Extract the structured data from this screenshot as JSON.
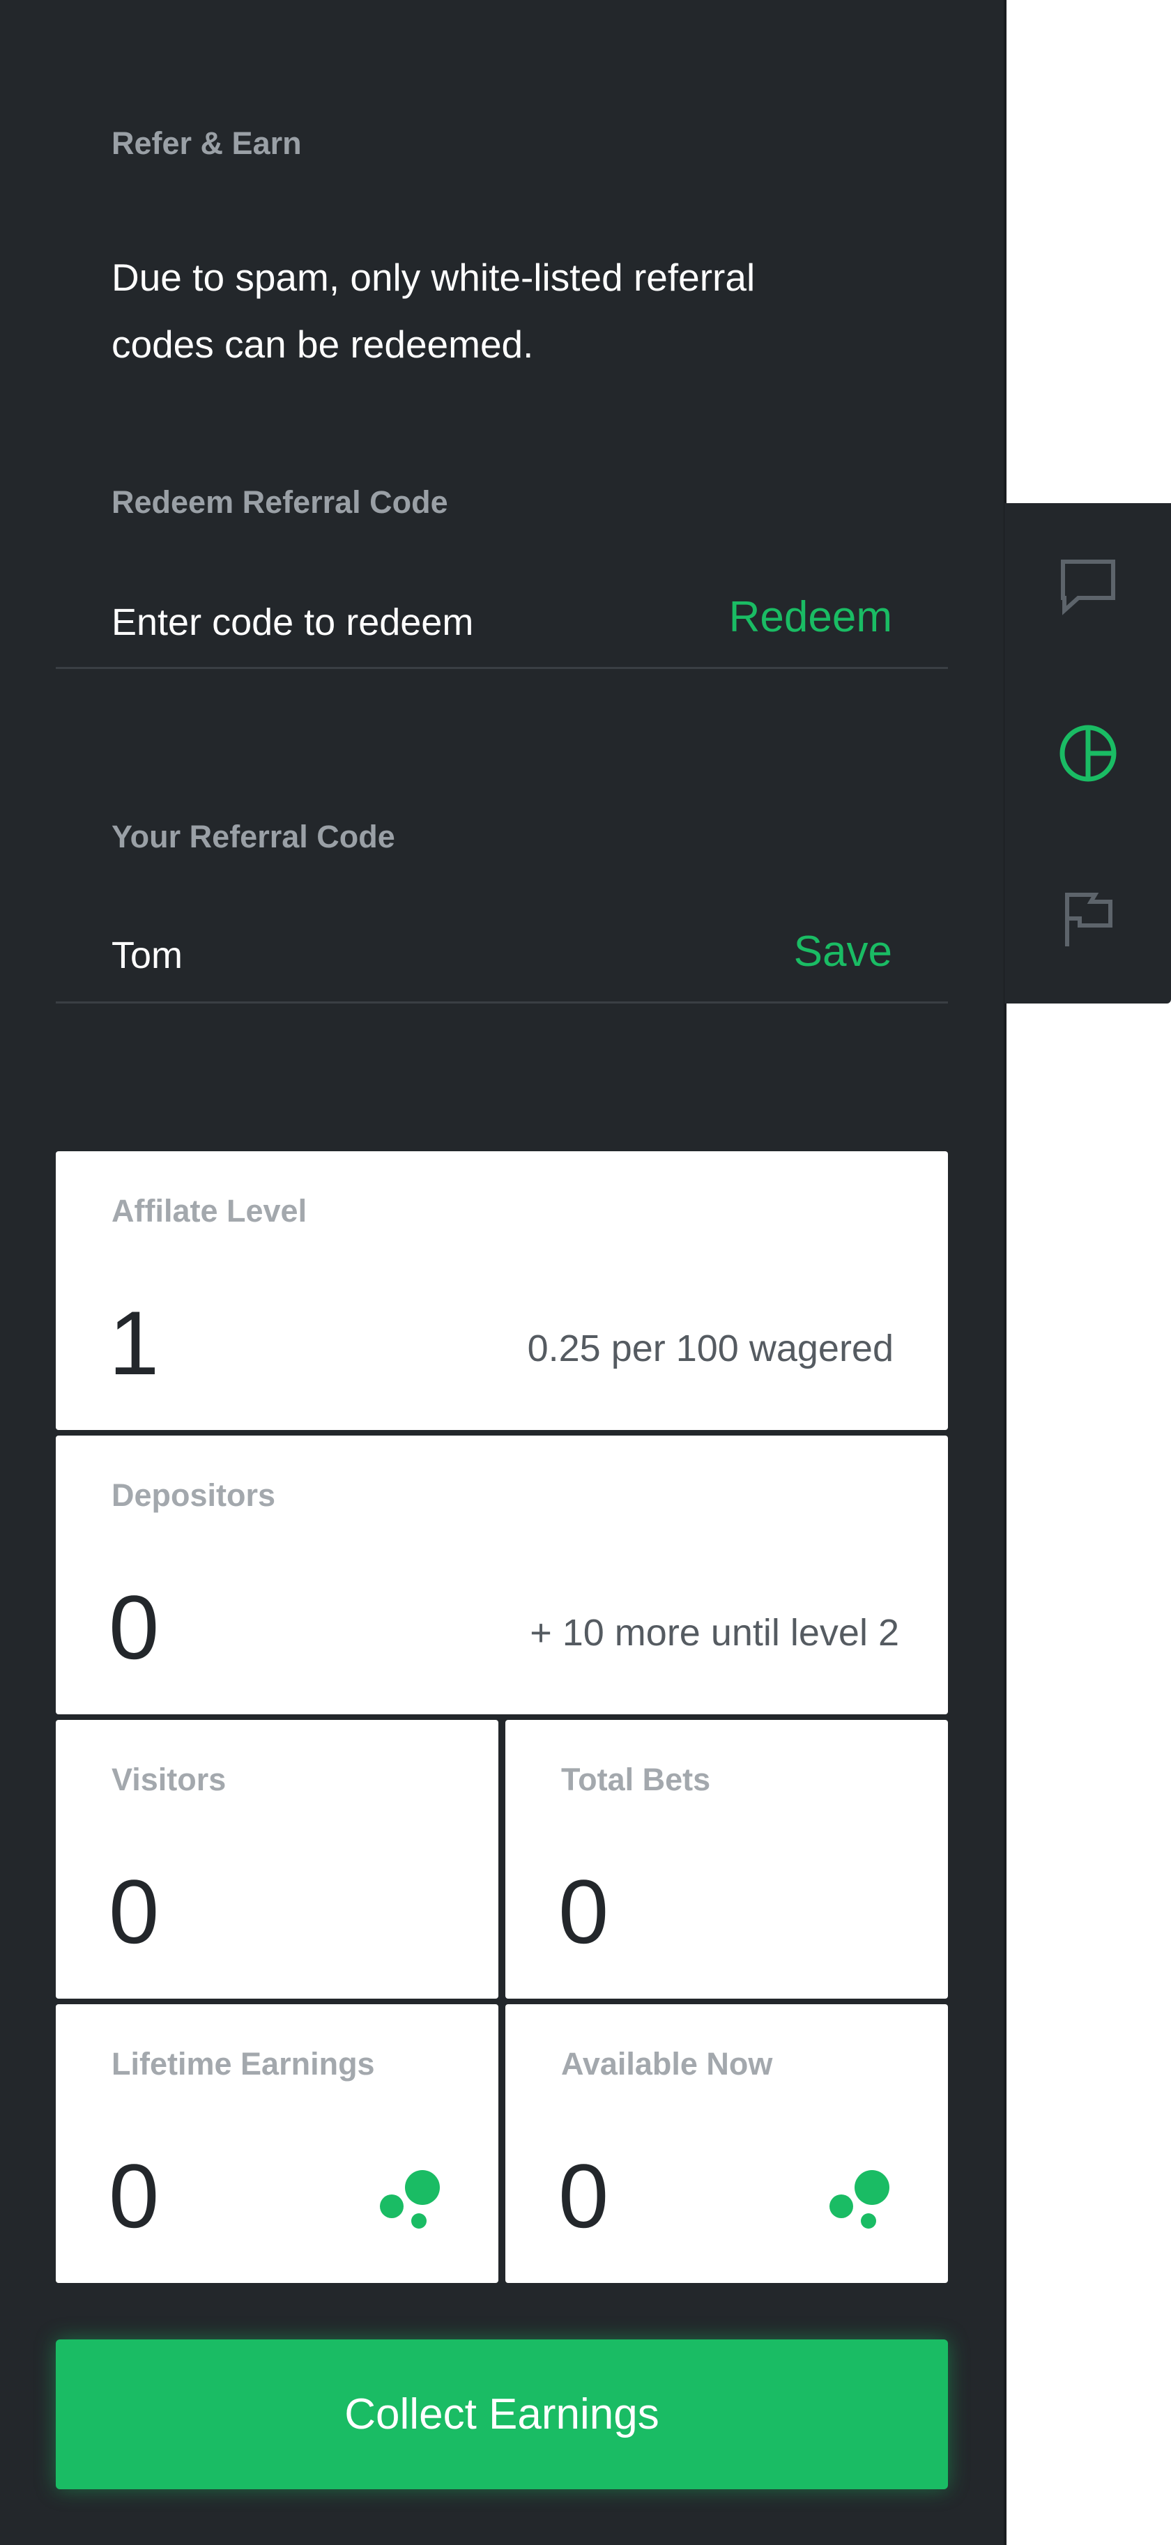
{
  "refer": {
    "title": "Refer & Earn",
    "notice": "Due to spam, only white-listed referral codes can be redeemed."
  },
  "redeem": {
    "title": "Redeem Referral Code",
    "placeholder": "Enter code to redeem",
    "action_label": "Redeem"
  },
  "your_code": {
    "title": "Your Referral Code",
    "value": "Tom",
    "action_label": "Save"
  },
  "stats": {
    "affiliate_level": {
      "label": "Affilate Level",
      "value": "1",
      "note": "0.25 per 100 wagered"
    },
    "depositors": {
      "label": "Depositors",
      "value": "0",
      "note": "+ 10 more until level 2"
    },
    "visitors": {
      "label": "Visitors",
      "value": "0"
    },
    "total_bets": {
      "label": "Total Bets",
      "value": "0"
    },
    "lifetime_earnings": {
      "label": "Lifetime Earnings",
      "value": "0",
      "icon": "coins-icon"
    },
    "available_now": {
      "label": "Available Now",
      "value": "0",
      "icon": "coins-icon"
    }
  },
  "collect_button": {
    "label": "Collect Earnings"
  },
  "side_tabs": [
    {
      "icon": "chat-icon",
      "active": false
    },
    {
      "icon": "pie-chart-icon",
      "active": true
    },
    {
      "icon": "flag-icon",
      "active": false
    }
  ],
  "colors": {
    "panel_bg": "#23272b",
    "accent_green": "#1abc64",
    "muted_text": "#9aa0a6",
    "card_bg": "#ffffff"
  }
}
